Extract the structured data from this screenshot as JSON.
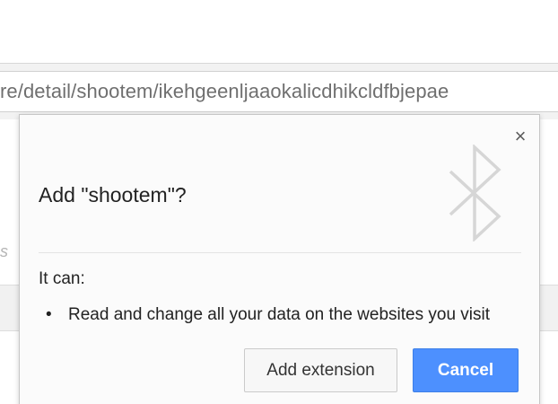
{
  "browser": {
    "url_text": "re/detail/shootem/ikehgeenljaaokalicdhikcldfbjepae",
    "page_fragment": "s"
  },
  "dialog": {
    "title": "Add \"shootem\"?",
    "close_glyph": "×",
    "icon": "bluetooth-icon",
    "permissions_heading": "It can:",
    "permissions": [
      {
        "bullet": "•",
        "text": "Read and change all your data on the websites you visit"
      }
    ],
    "add_button_label": "Add extension",
    "cancel_button_label": "Cancel",
    "colors": {
      "cancel_button": "#4d90fe",
      "icon": "#d6d6d6"
    }
  }
}
